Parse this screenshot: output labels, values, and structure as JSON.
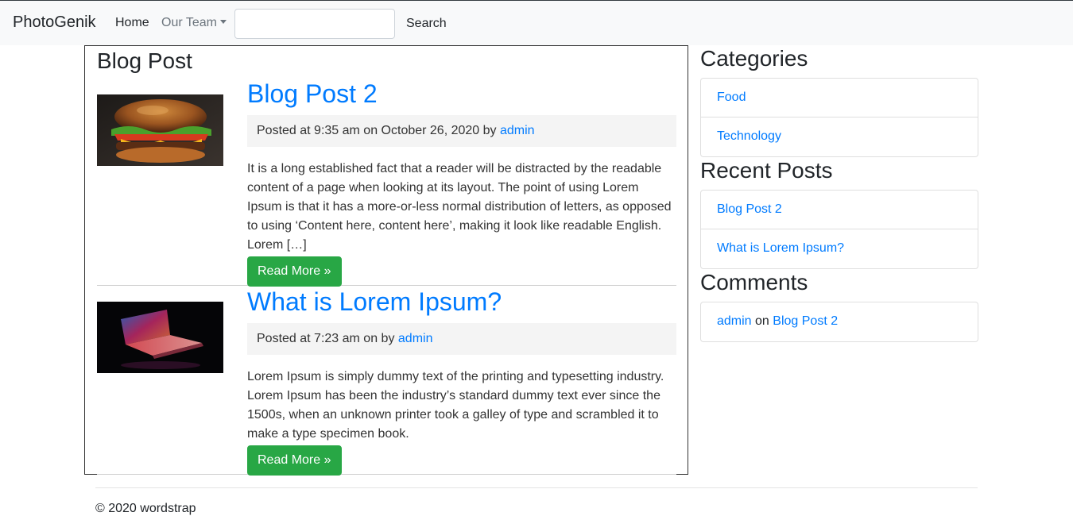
{
  "navbar": {
    "brand": "PhotoGenik",
    "home": "Home",
    "our_team": "Our Team",
    "search_value": "",
    "search_button": "Search"
  },
  "main": {
    "section_title": "Blog Post",
    "posts": [
      {
        "title": "Blog Post 2",
        "meta_prefix": "Posted at 9:35 am on October 26, 2020 by",
        "author": "admin",
        "excerpt": "It is a long established fact that a reader will be distracted by the readable content of a page when looking at its layout. The point of using Lorem Ipsum is that it has a more-or-less normal distribution of letters, as opposed to using ‘Content here, content here’, making it look like readable English. Lorem […]",
        "read_more": "Read More »",
        "thumbnail_icon": "burger-photo"
      },
      {
        "title": "What is Lorem Ipsum?",
        "meta_prefix": "Posted at 7:23 am on by",
        "author": "admin",
        "excerpt": "Lorem Ipsum is simply dummy text of the printing and typesetting industry. Lorem Ipsum has been the industry’s standard dummy text ever since the 1500s, when an unknown printer took a galley of type and scrambled it to make a type specimen book.",
        "read_more": "Read More »",
        "thumbnail_icon": "laptop-photo"
      }
    ]
  },
  "sidebar": {
    "categories_title": "Categories",
    "categories": [
      "Food",
      "Technology"
    ],
    "recent_title": "Recent Posts",
    "recent": [
      "Blog Post 2",
      "What is Lorem Ipsum?"
    ],
    "comments_title": "Comments",
    "comment": {
      "author": "admin",
      "on": "on",
      "post": "Blog Post 2"
    }
  },
  "footer": {
    "text": "© 2020 wordstrap"
  },
  "colors": {
    "link": "#007bff",
    "button": "#28a745",
    "navbar_bg": "#f8f9fa",
    "meta_bg": "#f4f4f4"
  }
}
